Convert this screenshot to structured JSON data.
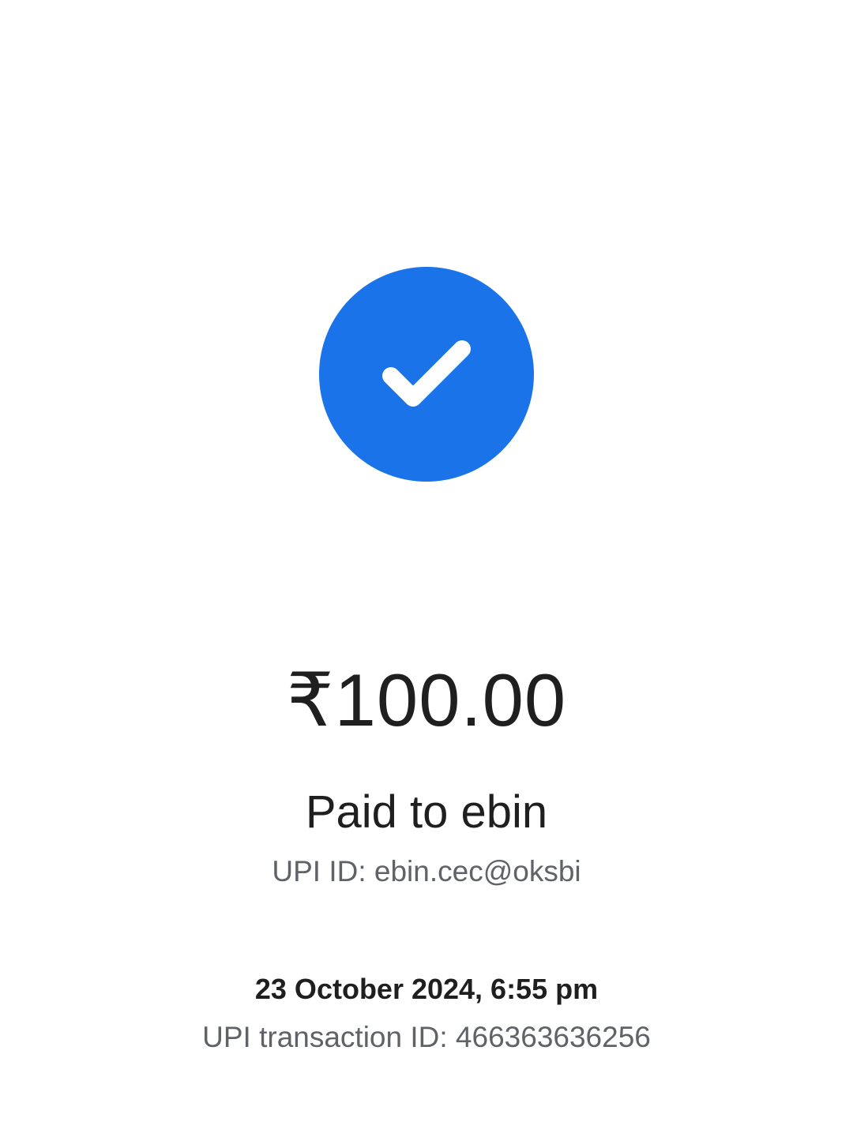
{
  "payment": {
    "status_icon": "check-circle-icon",
    "accent_color": "#1a73e8",
    "amount": "₹100.00",
    "paid_to": "Paid to ebin",
    "upi_id": "UPI ID: ebin.cec@oksbi",
    "timestamp": "23 October 2024, 6:55 pm",
    "transaction_id": "UPI transaction ID: 466363636256"
  }
}
